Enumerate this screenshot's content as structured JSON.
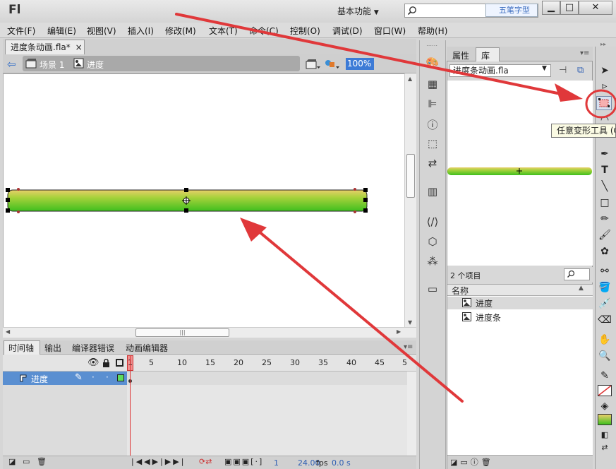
{
  "app": {
    "logo": "Fl",
    "workspace": "基本功能",
    "search_hint": "五笔字型",
    "window_buttons": {
      "minimize": "▁",
      "restore": "□",
      "close": "✕"
    }
  },
  "menu": [
    "文件(F)",
    "编辑(E)",
    "视图(V)",
    "插入(I)",
    "修改(M)",
    "文本(T)",
    "命令(C)",
    "控制(O)",
    "调试(D)",
    "窗口(W)",
    "帮助(H)"
  ],
  "document": {
    "tab_label": "进度条动画.fla*",
    "tab_close": "×",
    "scene_label": "场景 1",
    "symbol_label": "进度",
    "zoom": "100%"
  },
  "timeline": {
    "tabs": [
      "时间轴",
      "输出",
      "编译器错误",
      "动画编辑器"
    ],
    "frame_numbers": [
      "1",
      "5",
      "10",
      "15",
      "20",
      "25",
      "30",
      "35",
      "40",
      "45",
      "5"
    ],
    "layer_name": "进度",
    "status": {
      "current_frame": "1",
      "fps": "24.00",
      "fps_unit": "fps",
      "time": "0.0 s"
    }
  },
  "panels": {
    "properties_tab": "属性",
    "library_tab": "库",
    "library_file": "进度条动画.fla",
    "item_count": "2 个项目",
    "column_name": "名称",
    "items": [
      "进度",
      "进度条"
    ]
  },
  "tooltip": "任意变形工具 (Q)",
  "colors": {
    "bar_top": "#e8cf6a",
    "bar_bottom": "#3fbf1e",
    "annotation": "#e0383a",
    "layer_selected": "#5a8fd1"
  }
}
